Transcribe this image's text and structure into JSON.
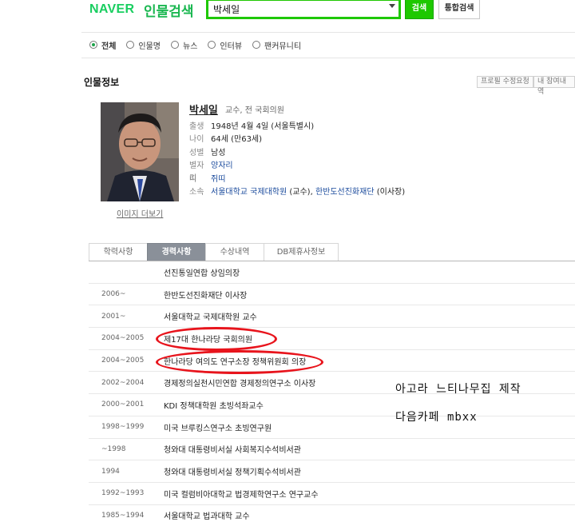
{
  "header": {
    "logo": "NAVER",
    "service": "인물검색",
    "search_value": "박세일",
    "search_button": "검색",
    "total_button": "통합검색"
  },
  "filters": [
    {
      "label": "전체",
      "selected": true
    },
    {
      "label": "인물명",
      "selected": false
    },
    {
      "label": "뉴스",
      "selected": false
    },
    {
      "label": "인터뷰",
      "selected": false
    },
    {
      "label": "팬커뮤니티",
      "selected": false
    }
  ],
  "section": {
    "title": "인물정보",
    "edit_request": "프로필 수정요청",
    "my_info": "내 참여내역"
  },
  "profile": {
    "name": "박세일",
    "title": "교수, 전 국회의원",
    "image_more": "이미지 더보기",
    "rows": [
      {
        "key": "출생",
        "value": "1948년 4월 4일 (서울특별시)"
      },
      {
        "key": "나이",
        "value": "64세 (만63세)"
      },
      {
        "key": "성별",
        "value": "남성"
      },
      {
        "key": "별자리",
        "value": "양자리"
      },
      {
        "key": "띠",
        "value": "쥐띠"
      },
      {
        "key": "소속",
        "link1": "서울대학교 국제대학원",
        "mid": " (교수), ",
        "link2": "한반도선진화재단",
        "tail": " (이사장)"
      }
    ]
  },
  "tabs": [
    "학력사항",
    "경력사항",
    "수상내역",
    "DB제휴사정보"
  ],
  "active_tab": "경력사항",
  "career": [
    {
      "year": "",
      "desc": "선진통일연합 상임의장"
    },
    {
      "year": "2006~",
      "desc": "한반도선진화재단 이사장"
    },
    {
      "year": "2001~",
      "desc": "서울대학교 국제대학원 교수"
    },
    {
      "year": "2004~2005",
      "desc": "제17대 한나라당 국회의원"
    },
    {
      "year": "2004~2005",
      "desc": "한나라당 여의도 연구소장 정책위원회 의장"
    },
    {
      "year": "2002~2004",
      "desc": "경제정의실천시민연합 경제정의연구소 이사장"
    },
    {
      "year": "2000~2001",
      "desc": "KDI 정책대학원 초빙석좌교수"
    },
    {
      "year": "1998~1999",
      "desc": "미국 브루킹스연구소 초빙연구원"
    },
    {
      "year": "~1998",
      "desc": "청와대 대통령비서실 사회복지수석비서관"
    },
    {
      "year": "1994",
      "desc": "청와대 대통령비서실 정책기획수석비서관"
    },
    {
      "year": "1992~1993",
      "desc": "미국 컬럼비아대학교 법경제학연구소 연구교수"
    },
    {
      "year": "1985~1994",
      "desc": "서울대학교 법과대학 교수"
    }
  ],
  "watermark": {
    "line1": "아고라 느티나무집 제작",
    "line2": "다음카페 mbxx"
  },
  "colors": {
    "brand": "#1ec800",
    "highlight": "#e8141c",
    "link": "#1a4a9c"
  }
}
